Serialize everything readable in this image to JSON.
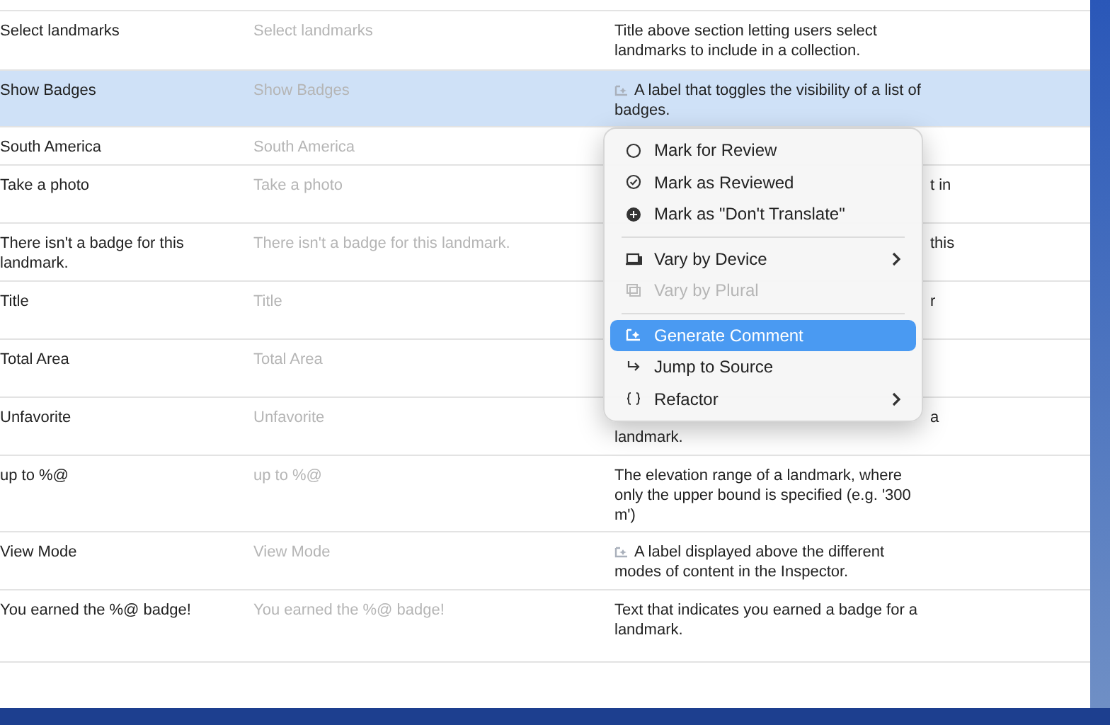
{
  "table": {
    "rows": [
      {
        "key": "Select landmarks",
        "source": "Select landmarks",
        "comment": [
          "Title above section letting users select",
          "landmarks to include in a collection."
        ],
        "generated": false,
        "covered": false,
        "selected": false
      },
      {
        "key": "Show Badges",
        "source": "Show Badges",
        "comment": [
          "A label that toggles the visibility of a list of",
          "badges."
        ],
        "generated": true,
        "covered": false,
        "selected": true
      },
      {
        "key": "South America",
        "source": "South America",
        "comment": [],
        "selected": false
      },
      {
        "key": "Take a photo",
        "source": "Take a photo",
        "comment": [
          "t in"
        ],
        "generated": false,
        "covered": true,
        "selected": false
      },
      {
        "key": "There isn't a badge for this landmark.",
        "source": "There isn't a badge for this landmark.",
        "comment": [
          "this"
        ],
        "generated": false,
        "covered": true,
        "selected": false
      },
      {
        "key": "Title",
        "source": "Title",
        "comment": [
          "r"
        ],
        "generated": false,
        "covered": true,
        "selected": false
      },
      {
        "key": "Total Area",
        "source": "Total Area",
        "comment": [],
        "selected": false
      },
      {
        "key": "Unfavorite",
        "source": "Unfavorite",
        "comment": [
          "a",
          "landmark."
        ],
        "generated": false,
        "covered": true,
        "selected": false
      },
      {
        "key": "up to %@",
        "source": "up to %@",
        "comment": [
          "The elevation range of a landmark, where",
          "only the upper bound is specified (e.g. '300",
          "m')"
        ],
        "generated": false,
        "covered": false,
        "selected": false
      },
      {
        "key": "View Mode",
        "source": "View Mode",
        "comment": [
          "A label displayed above the different",
          "modes of content in the Inspector."
        ],
        "generated": true,
        "covered": false,
        "selected": false
      },
      {
        "key": "You earned the %@ badge!",
        "source": "You earned the %@ badge!",
        "comment": [
          "Text that indicates you earned a badge for a",
          "landmark."
        ],
        "generated": false,
        "covered": false,
        "selected": false
      }
    ]
  },
  "context_menu": {
    "items": [
      {
        "kind": "item",
        "label": "Mark for Review",
        "disabled": false,
        "selected": false,
        "submenu": false
      },
      {
        "kind": "item",
        "label": "Mark as Reviewed",
        "disabled": false,
        "selected": false,
        "submenu": false
      },
      {
        "kind": "item",
        "label": "Mark as \"Don't Translate\"",
        "disabled": false,
        "selected": false,
        "submenu": false
      },
      {
        "kind": "separator"
      },
      {
        "kind": "item",
        "label": "Vary by Device",
        "disabled": false,
        "selected": false,
        "submenu": true
      },
      {
        "kind": "item",
        "label": "Vary by Plural",
        "disabled": true,
        "selected": false,
        "submenu": false
      },
      {
        "kind": "separator"
      },
      {
        "kind": "item",
        "label": "Generate Comment",
        "disabled": false,
        "selected": true,
        "submenu": false
      },
      {
        "kind": "item",
        "label": "Jump to Source",
        "disabled": false,
        "selected": false,
        "submenu": false
      },
      {
        "kind": "item",
        "label": "Refactor",
        "disabled": false,
        "selected": false,
        "submenu": true
      }
    ]
  }
}
